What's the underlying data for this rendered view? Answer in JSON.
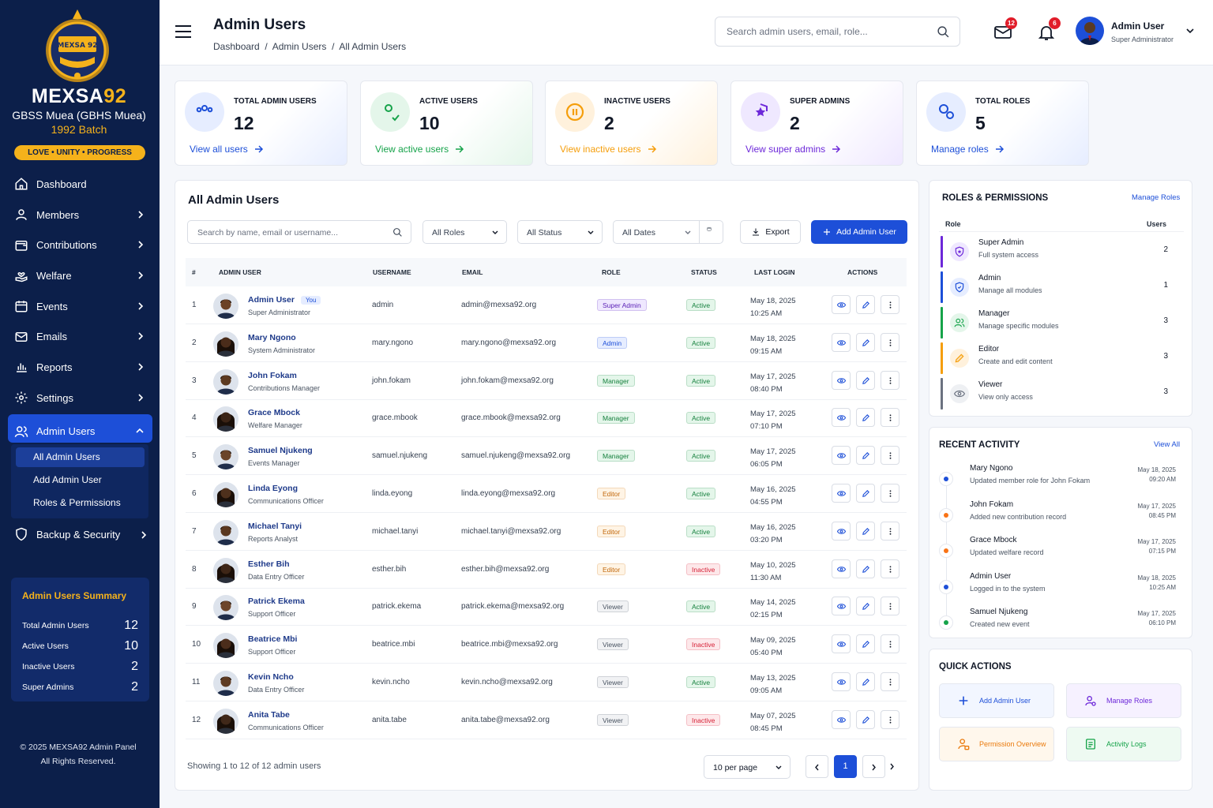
{
  "brand": {
    "name_white": "MEXSA",
    "name_gold": "92",
    "subtitle": "GBSS Muea (GBHS Muea)",
    "batch": "1992 Batch",
    "motto": "LOVE • UNITY • PROGRESS",
    "logo_text": "MEXSA 92"
  },
  "nav": [
    {
      "label": "Dashboard"
    },
    {
      "label": "Members"
    },
    {
      "label": "Contributions"
    },
    {
      "label": "Welfare"
    },
    {
      "label": "Events"
    },
    {
      "label": "Emails"
    },
    {
      "label": "Reports"
    },
    {
      "label": "Settings"
    },
    {
      "label": "Admin Users"
    }
  ],
  "subnav": [
    "All Admin Users",
    "Add Admin User",
    "Roles & Permissions"
  ],
  "nav_backup": "Backup & Security",
  "summary": {
    "title": "Admin Users Summary",
    "rows": [
      {
        "label": "Total Admin Users",
        "value": "12"
      },
      {
        "label": "Active Users",
        "value": "10"
      },
      {
        "label": "Inactive Users",
        "value": "2"
      },
      {
        "label": "Super Admins",
        "value": "2"
      }
    ]
  },
  "footer": {
    "line1": "© 2025 MEXSA92 Admin Panel",
    "line2": "All Rights Reserved."
  },
  "header": {
    "title": "Admin Users",
    "breadcrumb": "Dashboard  /  Admin Users  /  All Admin Users",
    "search_placeholder": "Search admin users, email, role...",
    "mail_count": "12",
    "notif_count": "6",
    "user_name": "Admin User",
    "user_role": "Super Administrator"
  },
  "stats": [
    {
      "label": "TOTAL ADMIN USERS",
      "value": "12",
      "link": "View all users",
      "color": "#1d4fd8",
      "bg": "#e6edff"
    },
    {
      "label": "ACTIVE USERS",
      "value": "10",
      "link": "View active users",
      "color": "#16a34a",
      "bg": "#e4f6ea"
    },
    {
      "label": "INACTIVE USERS",
      "value": "2",
      "link": "View inactive users",
      "color": "#f59e0b",
      "bg": "#fff1dc"
    },
    {
      "label": "SUPER ADMINS",
      "value": "2",
      "link": "View super admins",
      "color": "#6d28d9",
      "bg": "#efe8ff"
    },
    {
      "label": "TOTAL ROLES",
      "value": "5",
      "link": "Manage roles",
      "color": "#1d4fd8",
      "bg": "#e6edff"
    }
  ],
  "table": {
    "title": "All Admin Users",
    "search_placeholder": "Search by name, email or username...",
    "filter_roles": "All Roles",
    "filter_status": "All Status",
    "filter_dates": "All Dates",
    "export_label": "Export",
    "add_label": "Add Admin User",
    "you_badge": "You",
    "columns": [
      "#",
      "ADMIN USER",
      "USERNAME",
      "EMAIL",
      "ROLE",
      "STATUS",
      "LAST LOGIN",
      "ACTIONS"
    ],
    "rows": [
      {
        "n": "1",
        "name": "Admin User",
        "title": "Super Administrator",
        "username": "admin",
        "email": "admin@mexsa92.org",
        "role": "Super Admin",
        "status": "Active",
        "date": "May 18, 2025",
        "time": "10:25 AM"
      },
      {
        "n": "2",
        "name": "Mary Ngono",
        "title": "System Administrator",
        "username": "mary.ngono",
        "email": "mary.ngono@mexsa92.org",
        "role": "Admin",
        "status": "Active",
        "date": "May 18, 2025",
        "time": "09:15 AM"
      },
      {
        "n": "3",
        "name": "John Fokam",
        "title": "Contributions Manager",
        "username": "john.fokam",
        "email": "john.fokam@mexsa92.org",
        "role": "Manager",
        "status": "Active",
        "date": "May 17, 2025",
        "time": "08:40 PM"
      },
      {
        "n": "4",
        "name": "Grace Mbock",
        "title": "Welfare Manager",
        "username": "grace.mbook",
        "email": "grace.mbook@mexsa92.org",
        "role": "Manager",
        "status": "Active",
        "date": "May 17, 2025",
        "time": "07:10 PM"
      },
      {
        "n": "5",
        "name": "Samuel Njukeng",
        "title": "Events Manager",
        "username": "samuel.njukeng",
        "email": "samuel.njukeng@mexsa92.org",
        "role": "Manager",
        "status": "Active",
        "date": "May 17, 2025",
        "time": "06:05 PM"
      },
      {
        "n": "6",
        "name": "Linda Eyong",
        "title": "Communications Officer",
        "username": "linda.eyong",
        "email": "linda.eyong@mexsa92.org",
        "role": "Editor",
        "status": "Active",
        "date": "May 16, 2025",
        "time": "04:55 PM"
      },
      {
        "n": "7",
        "name": "Michael Tanyi",
        "title": "Reports Analyst",
        "username": "michael.tanyi",
        "email": "michael.tanyi@mexsa92.org",
        "role": "Editor",
        "status": "Active",
        "date": "May 16, 2025",
        "time": "03:20 PM"
      },
      {
        "n": "8",
        "name": "Esther Bih",
        "title": "Data Entry Officer",
        "username": "esther.bih",
        "email": "esther.bih@mexsa92.org",
        "role": "Editor",
        "status": "Inactive",
        "date": "May 10, 2025",
        "time": "11:30 AM"
      },
      {
        "n": "9",
        "name": "Patrick Ekema",
        "title": "Support Officer",
        "username": "patrick.ekema",
        "email": "patrick.ekema@mexsa92.org",
        "role": "Viewer",
        "status": "Active",
        "date": "May 14, 2025",
        "time": "02:15 PM"
      },
      {
        "n": "10",
        "name": "Beatrice Mbi",
        "title": "Support Officer",
        "username": "beatrice.mbi",
        "email": "beatrice.mbi@mexsa92.org",
        "role": "Viewer",
        "status": "Inactive",
        "date": "May 09, 2025",
        "time": "05:40 PM"
      },
      {
        "n": "11",
        "name": "Kevin Ncho",
        "title": "Data Entry Officer",
        "username": "kevin.ncho",
        "email": "kevin.ncho@mexsa92.org",
        "role": "Viewer",
        "status": "Active",
        "date": "May 13, 2025",
        "time": "09:05 AM"
      },
      {
        "n": "12",
        "name": "Anita Tabe",
        "title": "Communications Officer",
        "username": "anita.tabe",
        "email": "anita.tabe@mexsa92.org",
        "role": "Viewer",
        "status": "Inactive",
        "date": "May 07, 2025",
        "time": "08:45 PM"
      }
    ],
    "showing": "Showing 1 to 12 of 12 admin users",
    "per_page": "10 per page",
    "current_page": "1"
  },
  "roles": {
    "title": "ROLES & PERMISSIONS",
    "link": "Manage Roles",
    "col_role": "Role",
    "col_users": "Users",
    "items": [
      {
        "name": "Super Admin",
        "desc": "Full system access",
        "count": "2",
        "color": "#6d28d9",
        "bg": "#efe8ff",
        "icon": "shield-star-icon"
      },
      {
        "name": "Admin",
        "desc": "Manage all modules",
        "count": "1",
        "color": "#1d4fd8",
        "bg": "#e6edff",
        "icon": "shield-icon"
      },
      {
        "name": "Manager",
        "desc": "Manage specific modules",
        "count": "3",
        "color": "#16a34a",
        "bg": "#e4f6ea",
        "icon": "users-icon"
      },
      {
        "name": "Editor",
        "desc": "Create and edit content",
        "count": "3",
        "color": "#f59e0b",
        "bg": "#fff1dc",
        "icon": "pencil-icon"
      },
      {
        "name": "Viewer",
        "desc": "View only access",
        "count": "3",
        "color": "#6b7280",
        "bg": "#eef0f3",
        "icon": "eye-icon"
      }
    ]
  },
  "activity": {
    "title": "RECENT ACTIVITY",
    "link": "View All",
    "items": [
      {
        "name": "Mary Ngono",
        "desc": "Updated member role for John Fokam",
        "date": "May 18, 2025",
        "time": "09:20 AM",
        "color": "#1d4fd8"
      },
      {
        "name": "John Fokam",
        "desc": "Added new contribution record",
        "date": "May 17, 2025",
        "time": "08:45 PM",
        "color": "#f97316"
      },
      {
        "name": "Grace Mbock",
        "desc": "Updated welfare record",
        "date": "May 17, 2025",
        "time": "07:15 PM",
        "color": "#f97316"
      },
      {
        "name": "Admin User",
        "desc": "Logged in to the system",
        "date": "May 18, 2025",
        "time": "10:25 AM",
        "color": "#1d4fd8"
      },
      {
        "name": "Samuel Njukeng",
        "desc": "Created new event",
        "date": "May 17, 2025",
        "time": "06:10 PM",
        "color": "#16a34a"
      }
    ]
  },
  "quick": {
    "title": "QUICK ACTIONS",
    "items": [
      {
        "label": "Add Admin User",
        "color": "#1d4fd8",
        "bg": "#f2f6ff"
      },
      {
        "label": "Manage Roles",
        "color": "#6d28d9",
        "bg": "#f6f1ff"
      },
      {
        "label": "Permission Overview",
        "color": "#ea7a0c",
        "bg": "#fff7ec"
      },
      {
        "label": "Activity Logs",
        "color": "#16a34a",
        "bg": "#eefaf2"
      }
    ]
  },
  "colors": {
    "role_pills": {
      "Super Admin": [
        "#efe8ff",
        "#5b21b6"
      ],
      "Admin": [
        "#e6edff",
        "#1d4fd8"
      ],
      "Manager": [
        "#e4f6ea",
        "#15803d"
      ],
      "Editor": [
        "#fff4e5",
        "#c2680c"
      ],
      "Viewer": [
        "#f1f2f4",
        "#4b5563"
      ]
    },
    "status": {
      "Active": [
        "#e4f6ea",
        "#15803d"
      ],
      "Inactive": [
        "#fde8ea",
        "#d61f35"
      ]
    }
  }
}
